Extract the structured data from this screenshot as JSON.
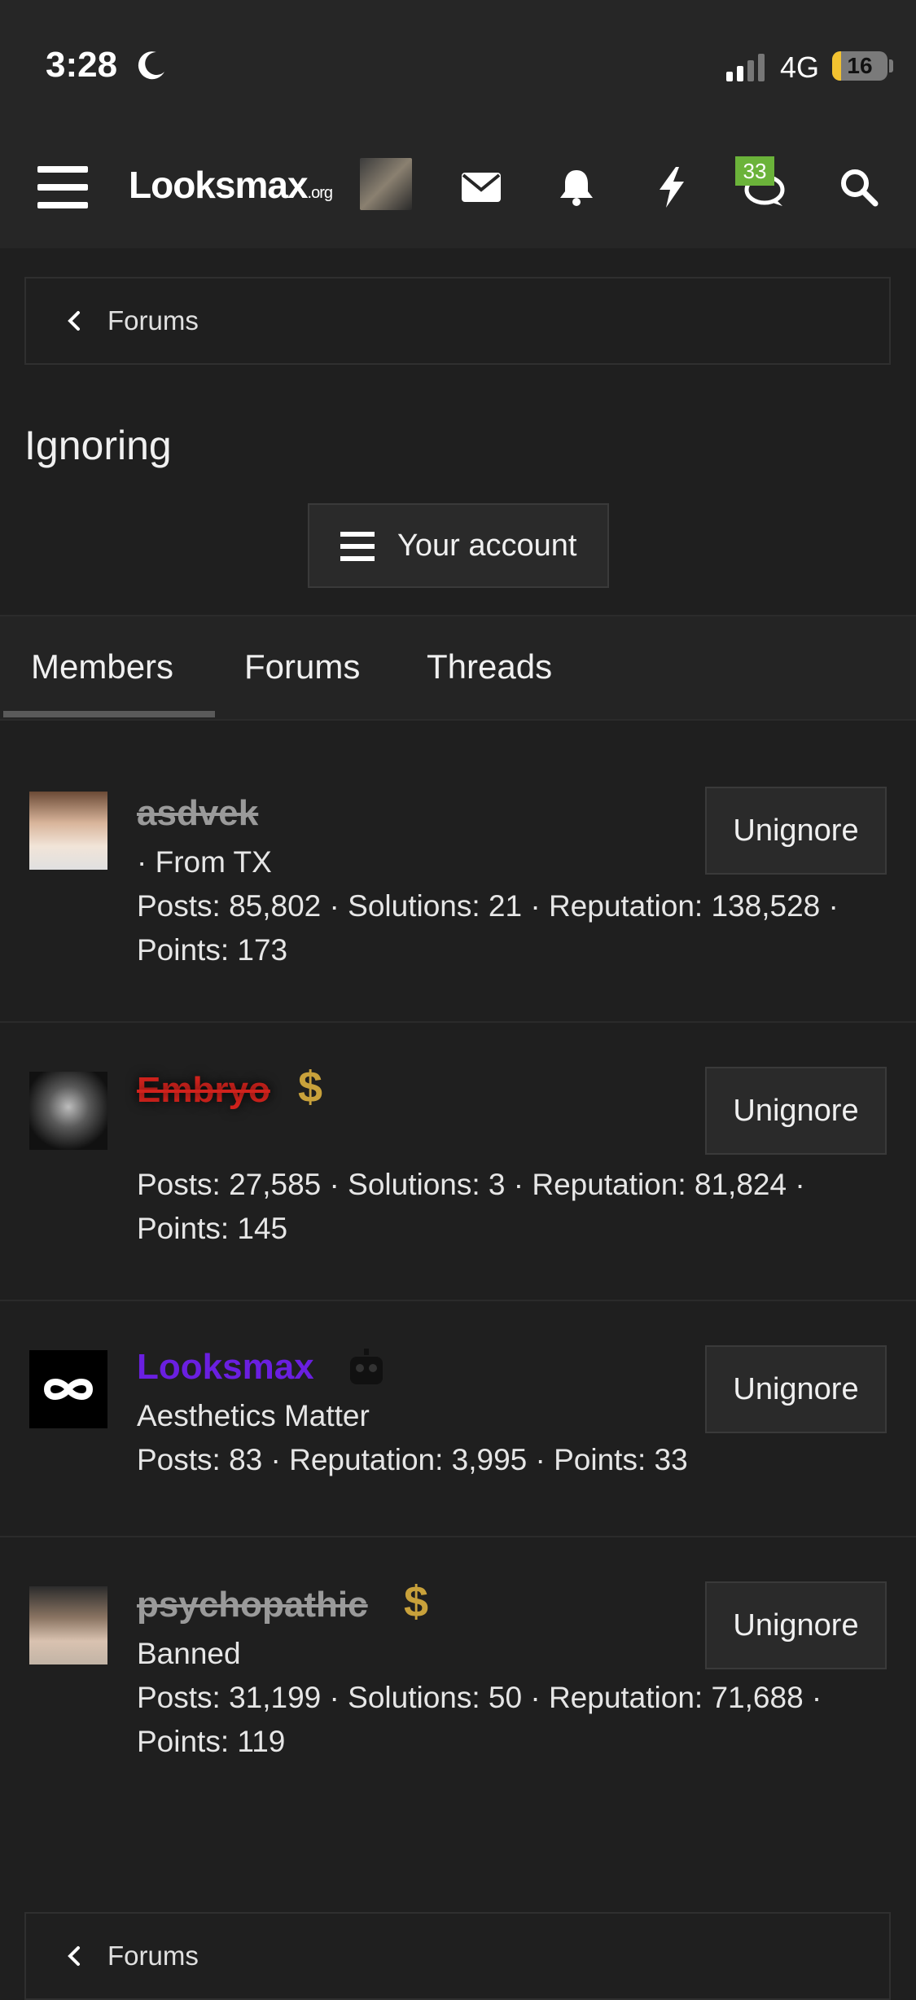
{
  "status_bar": {
    "time": "3:28",
    "network": "4G",
    "battery": "16",
    "battery_level": 0.16
  },
  "navbar": {
    "logo_main": "Looksmax",
    "logo_suffix": ".org",
    "chat_badge": "33",
    "icons": [
      "menu-icon",
      "envelope-icon",
      "bell-icon",
      "lightning-icon",
      "chat-icon",
      "search-icon"
    ]
  },
  "breadcrumb": {
    "label": "Forums"
  },
  "page": {
    "title": "Ignoring",
    "account_button": "Your account"
  },
  "tabs": [
    "Members",
    "Forums",
    "Threads"
  ],
  "active_tab": "Members",
  "members": [
    {
      "name": "asdvek",
      "name_style": "struck-gray",
      "subtitle": " · From TX",
      "stats": "Posts: 85,802 · Solutions: 21 · Reputation: 138,528 ·",
      "stats2": "Points: 173",
      "button": "Unignore"
    },
    {
      "name": "Embryo",
      "name_style": "struck-red",
      "subtitle": "",
      "stats": "Posts: 27,585 · Solutions: 3 · Reputation: 81,824 ·",
      "stats2": "Points: 145",
      "button": "Unignore"
    },
    {
      "name": "Looksmax",
      "name_style": "purple",
      "subtitle": "Aesthetics Matter",
      "stats": "Posts: 83 · Reputation: 3,995 · Points: 33",
      "stats2": "",
      "button": "Unignore"
    },
    {
      "name": "psychopathic",
      "name_style": "struck-gray",
      "subtitle": "Banned",
      "stats": "Posts: 31,199 · Solutions: 50 · Reputation: 71,688 ·",
      "stats2": "Points: 119",
      "button": "Unignore"
    }
  ],
  "colors": {
    "background": "#1f1f1f",
    "header": "#262626",
    "accent_purple": "#6a1fe0",
    "accent_red": "#d0221c",
    "badge_green": "#6bb33a",
    "dollar_gold": "#c8a13b"
  }
}
